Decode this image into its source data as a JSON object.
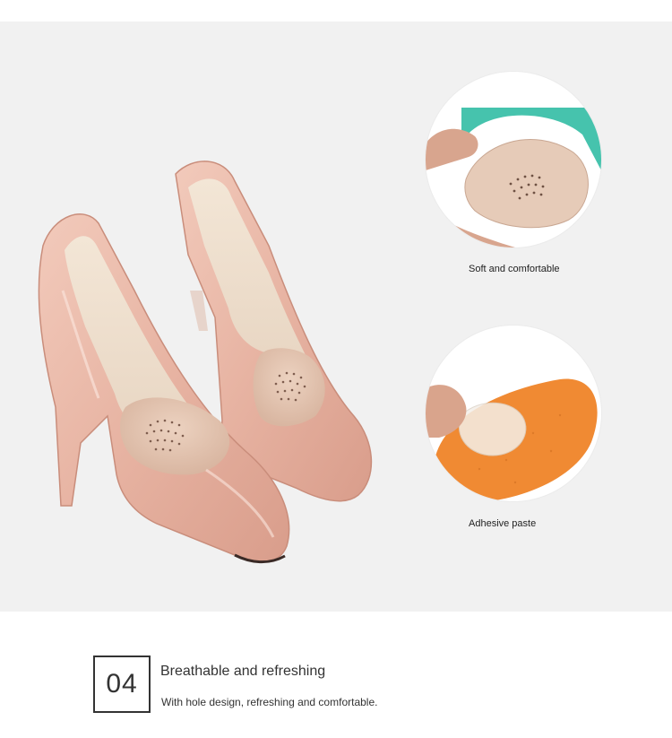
{
  "hero": {
    "image_subject": "pink-patent-pumps-with-forefoot-pads",
    "captions": {
      "soft": "Soft and comfortable",
      "adhesive": "Adhesive paste"
    }
  },
  "feature": {
    "number": "04",
    "title": "Breathable and refreshing",
    "description": "With hole design, refreshing and comfortable."
  },
  "colors": {
    "background": "#f1f1f1",
    "shoe_pink": "#e8b7a6",
    "pad_beige": "#e6cbb8",
    "teal": "#46c3ad",
    "orange": "#f08a33"
  }
}
